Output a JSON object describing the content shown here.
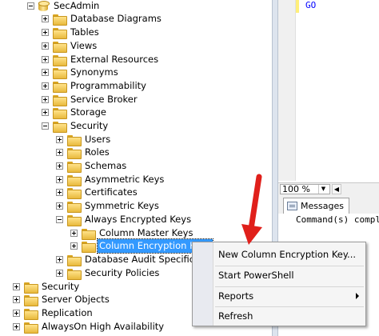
{
  "tree": {
    "database": "SecAdmin",
    "database_items": [
      "Database Diagrams",
      "Tables",
      "Views",
      "External Resources",
      "Synonyms",
      "Programmability",
      "Service Broker",
      "Storage"
    ],
    "security": "Security",
    "security_items": [
      "Users",
      "Roles",
      "Schemas",
      "Asymmetric Keys",
      "Certificates",
      "Symmetric Keys"
    ],
    "always_encrypted": "Always Encrypted Keys",
    "always_encrypted_items": [
      "Column Master Keys",
      "Column Encryption Keys"
    ],
    "security_items_after": [
      "Database Audit Specifications",
      "Security Policies"
    ],
    "server_items": [
      "Security",
      "Server Objects",
      "Replication",
      "AlwaysOn High Availability"
    ]
  },
  "editor": {
    "code_line": "GO",
    "zoom": "100 %"
  },
  "results": {
    "tab_label": "Messages",
    "message": "Command(s) compl"
  },
  "context_menu": {
    "items": [
      "New Column Encryption Key...",
      "Start PowerShell",
      "Reports",
      "Refresh"
    ]
  },
  "colors": {
    "selection": "#3399ff",
    "annotation_arrow": "#e0201b"
  }
}
